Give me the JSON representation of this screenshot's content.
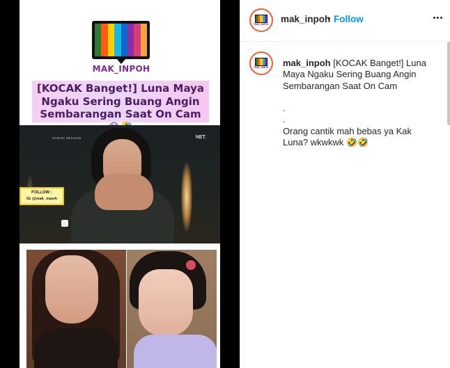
{
  "post": {
    "media": {
      "logo_text": "MAK_INPOH",
      "headline": "[KOCAK Banget!] Luna Maya Ngaku Sering Buang Angin Sembarangan Saat On Cam 😂🤣",
      "video_caption_left": "SARAH SECHAN",
      "video_caption_right": "NET.",
      "follow_title": "FOLLOW :",
      "follow_handle": "IG @mak_inpoh",
      "logo_colors": [
        "#2c7b34",
        "#ff5b0f",
        "#ffcf00",
        "#18b6e6",
        "#0a6ad1",
        "#8e2ca1",
        "#d83c78",
        "#f0a53b"
      ]
    },
    "header": {
      "username": "mak_inpoh",
      "bullet": "•",
      "follow_label": "Follow",
      "more_icon": "more-horizontal-icon"
    },
    "caption": {
      "username": "mak_inpoh",
      "text": "[KOCAK Banget!] Luna Maya Ngaku Sering Buang Angin Sembarangan Saat On Cam\n\n.\n.\nOrang cantik mah bebas ya Kak Luna? wkwkwk 🤣🤣"
    },
    "avatar_label": "MAK_INPOH"
  }
}
